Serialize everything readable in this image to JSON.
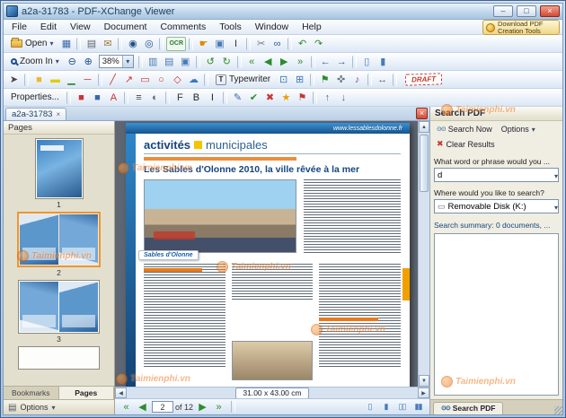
{
  "window": {
    "title": "a2a-31783 - PDF-XChange Viewer"
  },
  "ui": {
    "caret": "▾",
    "close": "×",
    "min": "–",
    "max": "□",
    "up": "▲",
    "down": "▼",
    "left": "◀",
    "right": "▶",
    "binoculars": "⊙⊙",
    "drive": "▭",
    "clear": "✖",
    "typewriter_icon": "T",
    "options_icon": "▤"
  },
  "menu": {
    "items": [
      {
        "label": "File",
        "n": "menu-file",
        "t": "true"
      },
      {
        "label": "Edit",
        "n": "menu-edit",
        "t": "true"
      },
      {
        "label": "View",
        "n": "menu-view",
        "t": "true"
      },
      {
        "label": "Document",
        "n": "menu-document",
        "t": "true"
      },
      {
        "label": "Comments",
        "n": "menu-comments",
        "t": "true"
      },
      {
        "label": "Tools",
        "n": "menu-tools",
        "t": "true"
      },
      {
        "label": "Window",
        "n": "menu-window",
        "t": "true"
      },
      {
        "label": "Help",
        "n": "menu-help",
        "t": "true"
      }
    ]
  },
  "download": {
    "label": "Download PDF Creation Tools"
  },
  "toolbars": {
    "row1": {
      "open_label": "Open",
      "icons": [
        {
          "n": "save-icon",
          "g": "▦",
          "c": "#3a68a8",
          "t": "true"
        },
        {
          "n": "separator",
          "g": "",
          "c": "",
          "t": "false"
        },
        {
          "n": "print-icon",
          "g": "▤",
          "c": "#5a6570",
          "t": "true"
        },
        {
          "n": "email-icon",
          "g": "✉",
          "c": "#9a7a3a",
          "t": "true"
        },
        {
          "n": "separator",
          "g": "",
          "c": "",
          "t": "false"
        },
        {
          "n": "find-icon",
          "g": "◉",
          "c": "#1c4f8c",
          "t": "true"
        },
        {
          "n": "search-multiple-icon",
          "g": "◎",
          "c": "#1c4f8c",
          "t": "true"
        },
        {
          "n": "separator",
          "g": "",
          "c": "",
          "t": "false"
        },
        {
          "n": "ocr-button",
          "g": "OCR",
          "c": "#2e7d32",
          "t": "true"
        },
        {
          "n": "separator",
          "g": "",
          "c": "",
          "t": "false"
        },
        {
          "n": "hand-tool-icon",
          "g": "☛",
          "c": "#d98a00",
          "t": "true"
        },
        {
          "n": "snapshot-icon",
          "g": "▣",
          "c": "#4a7ab8",
          "t": "true"
        },
        {
          "n": "select-text-icon",
          "g": "I",
          "c": "#333333",
          "t": "true"
        },
        {
          "n": "separator",
          "g": "",
          "c": "",
          "t": "false"
        },
        {
          "n": "crop-icon",
          "g": "✂",
          "c": "#667788",
          "t": "true"
        },
        {
          "n": "link-tool-icon",
          "g": "∞",
          "c": "#2a5a9a",
          "t": "true"
        },
        {
          "n": "separator",
          "g": "",
          "c": "",
          "t": "false"
        },
        {
          "n": "undo-icon",
          "g": "↶",
          "c": "#2e8b2e",
          "t": "true"
        },
        {
          "n": "redo-icon",
          "g": "↷",
          "c": "#2e8b2e",
          "t": "true"
        }
      ]
    },
    "row2": {
      "zoom_in_label": "Zoom In",
      "zoom_value": "38%",
      "icons_a": [
        {
          "n": "zoom-out-icon",
          "g": "⊖",
          "c": "#1c4f8c",
          "t": "true"
        },
        {
          "n": "zoom-in-icon",
          "g": "⊕",
          "c": "#1c4f8c",
          "t": "true"
        }
      ],
      "icons_b": [
        {
          "n": "separator",
          "g": "",
          "c": "",
          "t": "false"
        },
        {
          "n": "fit-width-icon",
          "g": "▥",
          "c": "#4a7ab8",
          "t": "true"
        },
        {
          "n": "fit-visible-icon",
          "g": "▤",
          "c": "#4a7ab8",
          "t": "true"
        },
        {
          "n": "actual-size-icon",
          "g": "▣",
          "c": "#4a7ab8",
          "t": "true"
        },
        {
          "n": "separator",
          "g": "",
          "c": "",
          "t": "false"
        },
        {
          "n": "rotate-ccw-icon",
          "g": "↺",
          "c": "#2e8b2e",
          "t": "true"
        },
        {
          "n": "rotate-cw-icon",
          "g": "↻",
          "c": "#2e8b2e",
          "t": "true"
        },
        {
          "n": "separator",
          "g": "",
          "c": "",
          "t": "false"
        },
        {
          "n": "first-page-icon",
          "g": "«",
          "c": "#2e8b2e",
          "t": "true"
        },
        {
          "n": "prev-page-icon",
          "g": "◀",
          "c": "#2e8b2e",
          "t": "true"
        },
        {
          "n": "next-page-icon",
          "g": "▶",
          "c": "#2e8b2e",
          "t": "true"
        },
        {
          "n": "last-page-icon",
          "g": "»",
          "c": "#2e8b2e",
          "t": "true"
        },
        {
          "n": "separator",
          "g": "",
          "c": "",
          "t": "false"
        },
        {
          "n": "previous-view-icon",
          "g": "←",
          "c": "#2a5a9a",
          "t": "true"
        },
        {
          "n": "next-view-icon",
          "g": "→",
          "c": "#2a5a9a",
          "t": "true"
        },
        {
          "n": "separator",
          "g": "",
          "c": "",
          "t": "false"
        },
        {
          "n": "single-page-layout-icon",
          "g": "▯",
          "c": "#4a7ab8",
          "t": "true"
        },
        {
          "n": "continuous-layout-icon",
          "g": "▮",
          "c": "#4a7ab8",
          "t": "true"
        }
      ]
    },
    "row3": {
      "typewriter_label": "Typewriter",
      "draft_label": "DRAFT",
      "icons_a": [
        {
          "n": "select-comment-icon",
          "g": "➤",
          "c": "#444444",
          "t": "true"
        },
        {
          "n": "separator",
          "g": "",
          "c": "",
          "t": "false"
        },
        {
          "n": "sticky-note-icon",
          "g": "■",
          "c": "#f0b830",
          "t": "true"
        },
        {
          "n": "highlight-icon",
          "g": "▬",
          "c": "#e0cc00",
          "t": "true"
        },
        {
          "n": "underline-icon",
          "g": "▁",
          "c": "#2e8b2e",
          "t": "true"
        },
        {
          "n": "strikeout-icon",
          "g": "─",
          "c": "#cc3333",
          "t": "true"
        },
        {
          "n": "separator",
          "g": "",
          "c": "",
          "t": "false"
        },
        {
          "n": "line-icon",
          "g": "╱",
          "c": "#cc3333",
          "t": "true"
        },
        {
          "n": "arrow-icon",
          "g": "↗",
          "c": "#cc3333",
          "t": "true"
        },
        {
          "n": "rectangle-icon",
          "g": "▭",
          "c": "#cc3333",
          "t": "true"
        },
        {
          "n": "oval-icon",
          "g": "○",
          "c": "#cc3333",
          "t": "true"
        },
        {
          "n": "polygon-icon",
          "g": "◇",
          "c": "#cc3333",
          "t": "true"
        },
        {
          "n": "cloud-icon",
          "g": "☁",
          "c": "#3a78c0",
          "t": "true"
        },
        {
          "n": "separator",
          "g": "",
          "c": "",
          "t": "false"
        }
      ],
      "icons_b": [
        {
          "n": "callout-icon",
          "g": "⊡",
          "c": "#3a78c0",
          "t": "true"
        },
        {
          "n": "text-box-icon",
          "g": "⊞",
          "c": "#3a78c0",
          "t": "true"
        },
        {
          "n": "separator",
          "g": "",
          "c": "",
          "t": "false"
        },
        {
          "n": "stamp-icon",
          "g": "⚑",
          "c": "#2e8b2e",
          "t": "true"
        },
        {
          "n": "attach-file-icon",
          "g": "✜",
          "c": "#667788",
          "t": "true"
        },
        {
          "n": "sound-icon",
          "g": "♪",
          "c": "#7a4aa8",
          "t": "true"
        },
        {
          "n": "separator",
          "g": "",
          "c": "",
          "t": "false"
        },
        {
          "n": "measure-icon",
          "g": "↔",
          "c": "#556677",
          "t": "true"
        },
        {
          "n": "separator",
          "g": "",
          "c": "",
          "t": "false"
        }
      ]
    },
    "row4": {
      "properties_label": "Properties...",
      "icons": [
        {
          "n": "separator",
          "g": "",
          "c": "",
          "t": "false"
        },
        {
          "n": "fill-color-icon",
          "g": "■",
          "c": "#cc3333",
          "t": "true"
        },
        {
          "n": "stroke-color-icon",
          "g": "■",
          "c": "#3a68a8",
          "t": "true"
        },
        {
          "n": "text-color-icon",
          "g": "A",
          "c": "#cc3333",
          "t": "true"
        },
        {
          "n": "separator",
          "g": "",
          "c": "",
          "t": "false"
        },
        {
          "n": "line-style-icon",
          "g": "≡",
          "c": "#444444",
          "t": "true"
        },
        {
          "n": "opacity-icon",
          "g": "◐",
          "c": "#556677",
          "t": "true"
        },
        {
          "n": "separator",
          "g": "",
          "c": "",
          "t": "false"
        },
        {
          "n": "font-icon",
          "g": "F",
          "c": "#333333",
          "t": "true"
        },
        {
          "n": "bold-icon",
          "g": "B",
          "c": "#222222",
          "t": "true"
        },
        {
          "n": "italic-icon",
          "g": "I",
          "c": "#222222",
          "t": "true"
        },
        {
          "n": "separator",
          "g": "",
          "c": "",
          "t": "false"
        },
        {
          "n": "note-edit-icon",
          "g": "✎",
          "c": "#3a68a8",
          "t": "true"
        },
        {
          "n": "check-icon",
          "g": "✔",
          "c": "#2e8b2e",
          "t": "true"
        },
        {
          "n": "cross-icon",
          "g": "✖",
          "c": "#cc3333",
          "t": "true"
        },
        {
          "n": "star-icon",
          "g": "★",
          "c": "#e8a000",
          "t": "true"
        },
        {
          "n": "flag-icon",
          "g": "⚑",
          "c": "#cc3333",
          "t": "true"
        },
        {
          "n": "separator",
          "g": "",
          "c": "",
          "t": "false"
        },
        {
          "n": "move-up-icon",
          "g": "↑",
          "c": "#556677",
          "t": "true"
        },
        {
          "n": "move-down-icon",
          "g": "↓",
          "c": "#556677",
          "t": "true"
        }
      ]
    }
  },
  "doc_tab": {
    "label": "a2a-31783"
  },
  "pages_panel": {
    "title": "Pages",
    "thumbnails": [
      {
        "number": "1"
      },
      {
        "number": "2"
      },
      {
        "number": "3"
      }
    ],
    "tabs": [
      {
        "label": "Bookmarks"
      },
      {
        "label": "Pages"
      }
    ],
    "options_label": "Options"
  },
  "document": {
    "url_banner": "www.lessablesdolonne.fr",
    "section_title_1": "activités",
    "section_title_2": "municipales",
    "headline": "Les Sables d'Olonne 2010, la ville rêvée à la mer",
    "logo_text": "Sables d'Olonne",
    "size_label": "31.00 x 43.00 cm"
  },
  "search_panel": {
    "title": "Search PDF",
    "search_now": "Search Now",
    "options": "Options",
    "clear_results": "Clear Results",
    "phrase_label": "What word or phrase would you ...",
    "phrase_value": "d",
    "where_label": "Where would you like to search?",
    "where_value": "Removable Disk (K:)",
    "summary": "Search summary: 0 documents, ...",
    "tab_label": "Search PDF"
  },
  "status_bar": {
    "nav_left": [
      {
        "n": "first-page-button",
        "g": "«",
        "c": "#2e8b2e",
        "t": "true"
      },
      {
        "n": "prev-page-button",
        "g": "◀",
        "c": "#2e8b2e",
        "t": "true"
      }
    ],
    "page_value": "2",
    "of_label": "of 12",
    "nav_right": [
      {
        "n": "next-page-button",
        "g": "▶",
        "c": "#2e8b2e",
        "t": "true"
      },
      {
        "n": "last-page-button",
        "g": "»",
        "c": "#2e8b2e",
        "t": "true"
      }
    ],
    "view_icons": [
      {
        "n": "single-page-view-icon",
        "g": "▯",
        "c": "#4a7ab8",
        "t": "true"
      },
      {
        "n": "continuous-view-icon",
        "g": "▮",
        "c": "#4a7ab8",
        "t": "true"
      },
      {
        "n": "facing-view-icon",
        "g": "▯▯",
        "c": "#4a7ab8",
        "t": "true"
      },
      {
        "n": "facing-continuous-view-icon",
        "g": "▮▮",
        "c": "#4a7ab8",
        "t": "true"
      }
    ]
  },
  "watermark": {
    "text": "Taimienphi.vn"
  }
}
